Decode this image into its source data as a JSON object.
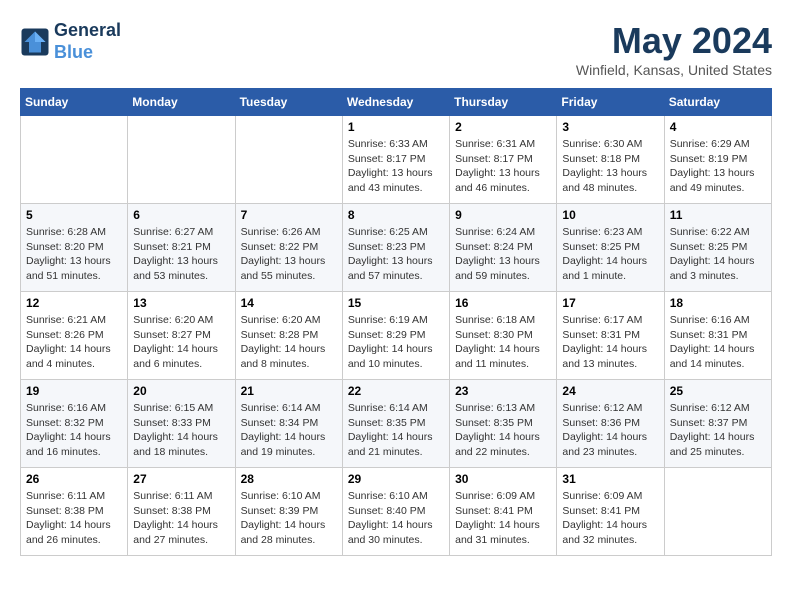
{
  "header": {
    "logo_line1": "General",
    "logo_line2": "Blue",
    "month_title": "May 2024",
    "location": "Winfield, Kansas, United States"
  },
  "weekdays": [
    "Sunday",
    "Monday",
    "Tuesday",
    "Wednesday",
    "Thursday",
    "Friday",
    "Saturday"
  ],
  "weeks": [
    [
      {
        "day": "",
        "info": []
      },
      {
        "day": "",
        "info": []
      },
      {
        "day": "",
        "info": []
      },
      {
        "day": "1",
        "info": [
          "Sunrise: 6:33 AM",
          "Sunset: 8:17 PM",
          "Daylight: 13 hours",
          "and 43 minutes."
        ]
      },
      {
        "day": "2",
        "info": [
          "Sunrise: 6:31 AM",
          "Sunset: 8:17 PM",
          "Daylight: 13 hours",
          "and 46 minutes."
        ]
      },
      {
        "day": "3",
        "info": [
          "Sunrise: 6:30 AM",
          "Sunset: 8:18 PM",
          "Daylight: 13 hours",
          "and 48 minutes."
        ]
      },
      {
        "day": "4",
        "info": [
          "Sunrise: 6:29 AM",
          "Sunset: 8:19 PM",
          "Daylight: 13 hours",
          "and 49 minutes."
        ]
      }
    ],
    [
      {
        "day": "5",
        "info": [
          "Sunrise: 6:28 AM",
          "Sunset: 8:20 PM",
          "Daylight: 13 hours",
          "and 51 minutes."
        ]
      },
      {
        "day": "6",
        "info": [
          "Sunrise: 6:27 AM",
          "Sunset: 8:21 PM",
          "Daylight: 13 hours",
          "and 53 minutes."
        ]
      },
      {
        "day": "7",
        "info": [
          "Sunrise: 6:26 AM",
          "Sunset: 8:22 PM",
          "Daylight: 13 hours",
          "and 55 minutes."
        ]
      },
      {
        "day": "8",
        "info": [
          "Sunrise: 6:25 AM",
          "Sunset: 8:23 PM",
          "Daylight: 13 hours",
          "and 57 minutes."
        ]
      },
      {
        "day": "9",
        "info": [
          "Sunrise: 6:24 AM",
          "Sunset: 8:24 PM",
          "Daylight: 13 hours",
          "and 59 minutes."
        ]
      },
      {
        "day": "10",
        "info": [
          "Sunrise: 6:23 AM",
          "Sunset: 8:25 PM",
          "Daylight: 14 hours",
          "and 1 minute."
        ]
      },
      {
        "day": "11",
        "info": [
          "Sunrise: 6:22 AM",
          "Sunset: 8:25 PM",
          "Daylight: 14 hours",
          "and 3 minutes."
        ]
      }
    ],
    [
      {
        "day": "12",
        "info": [
          "Sunrise: 6:21 AM",
          "Sunset: 8:26 PM",
          "Daylight: 14 hours",
          "and 4 minutes."
        ]
      },
      {
        "day": "13",
        "info": [
          "Sunrise: 6:20 AM",
          "Sunset: 8:27 PM",
          "Daylight: 14 hours",
          "and 6 minutes."
        ]
      },
      {
        "day": "14",
        "info": [
          "Sunrise: 6:20 AM",
          "Sunset: 8:28 PM",
          "Daylight: 14 hours",
          "and 8 minutes."
        ]
      },
      {
        "day": "15",
        "info": [
          "Sunrise: 6:19 AM",
          "Sunset: 8:29 PM",
          "Daylight: 14 hours",
          "and 10 minutes."
        ]
      },
      {
        "day": "16",
        "info": [
          "Sunrise: 6:18 AM",
          "Sunset: 8:30 PM",
          "Daylight: 14 hours",
          "and 11 minutes."
        ]
      },
      {
        "day": "17",
        "info": [
          "Sunrise: 6:17 AM",
          "Sunset: 8:31 PM",
          "Daylight: 14 hours",
          "and 13 minutes."
        ]
      },
      {
        "day": "18",
        "info": [
          "Sunrise: 6:16 AM",
          "Sunset: 8:31 PM",
          "Daylight: 14 hours",
          "and 14 minutes."
        ]
      }
    ],
    [
      {
        "day": "19",
        "info": [
          "Sunrise: 6:16 AM",
          "Sunset: 8:32 PM",
          "Daylight: 14 hours",
          "and 16 minutes."
        ]
      },
      {
        "day": "20",
        "info": [
          "Sunrise: 6:15 AM",
          "Sunset: 8:33 PM",
          "Daylight: 14 hours",
          "and 18 minutes."
        ]
      },
      {
        "day": "21",
        "info": [
          "Sunrise: 6:14 AM",
          "Sunset: 8:34 PM",
          "Daylight: 14 hours",
          "and 19 minutes."
        ]
      },
      {
        "day": "22",
        "info": [
          "Sunrise: 6:14 AM",
          "Sunset: 8:35 PM",
          "Daylight: 14 hours",
          "and 21 minutes."
        ]
      },
      {
        "day": "23",
        "info": [
          "Sunrise: 6:13 AM",
          "Sunset: 8:35 PM",
          "Daylight: 14 hours",
          "and 22 minutes."
        ]
      },
      {
        "day": "24",
        "info": [
          "Sunrise: 6:12 AM",
          "Sunset: 8:36 PM",
          "Daylight: 14 hours",
          "and 23 minutes."
        ]
      },
      {
        "day": "25",
        "info": [
          "Sunrise: 6:12 AM",
          "Sunset: 8:37 PM",
          "Daylight: 14 hours",
          "and 25 minutes."
        ]
      }
    ],
    [
      {
        "day": "26",
        "info": [
          "Sunrise: 6:11 AM",
          "Sunset: 8:38 PM",
          "Daylight: 14 hours",
          "and 26 minutes."
        ]
      },
      {
        "day": "27",
        "info": [
          "Sunrise: 6:11 AM",
          "Sunset: 8:38 PM",
          "Daylight: 14 hours",
          "and 27 minutes."
        ]
      },
      {
        "day": "28",
        "info": [
          "Sunrise: 6:10 AM",
          "Sunset: 8:39 PM",
          "Daylight: 14 hours",
          "and 28 minutes."
        ]
      },
      {
        "day": "29",
        "info": [
          "Sunrise: 6:10 AM",
          "Sunset: 8:40 PM",
          "Daylight: 14 hours",
          "and 30 minutes."
        ]
      },
      {
        "day": "30",
        "info": [
          "Sunrise: 6:09 AM",
          "Sunset: 8:41 PM",
          "Daylight: 14 hours",
          "and 31 minutes."
        ]
      },
      {
        "day": "31",
        "info": [
          "Sunrise: 6:09 AM",
          "Sunset: 8:41 PM",
          "Daylight: 14 hours",
          "and 32 minutes."
        ]
      },
      {
        "day": "",
        "info": []
      }
    ]
  ]
}
